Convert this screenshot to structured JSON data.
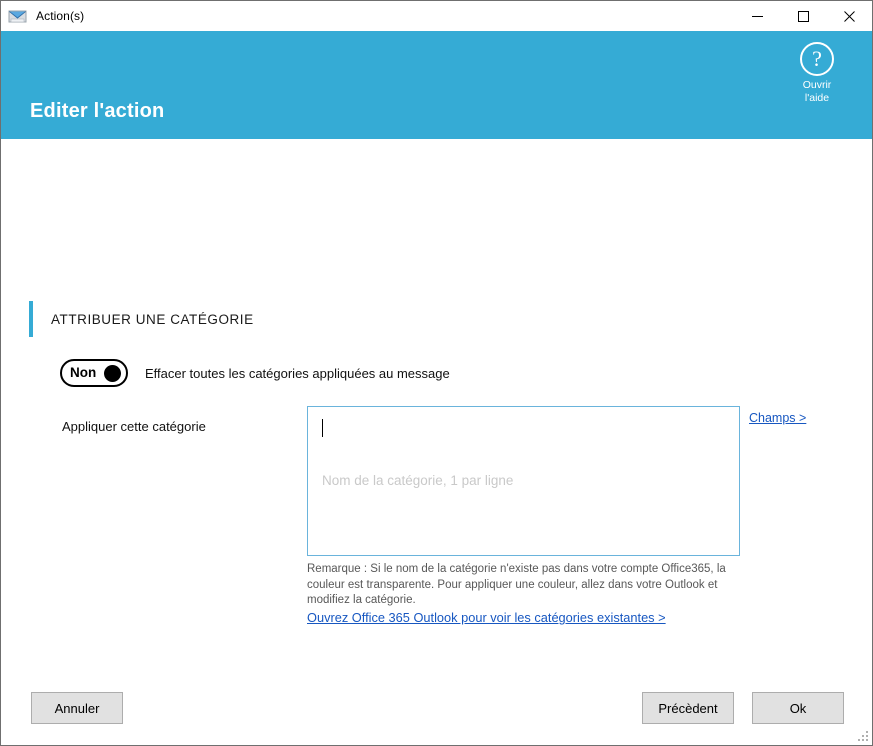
{
  "window": {
    "title": "Action(s)",
    "icon": "mail-envelope-icon",
    "controls": {
      "minimize": "minimize-icon",
      "maximize": "maximize-icon",
      "close": "close-icon"
    }
  },
  "header": {
    "title": "Editer l'action",
    "accent_color": "#35abd5",
    "help": {
      "icon": "question-mark-icon",
      "glyph": "?",
      "label_line1": "Ouvrir",
      "label_line2": "l'aide"
    }
  },
  "section": {
    "title": "ATTRIBUER UNE CATÉGORIE",
    "accent_color": "#35abd5"
  },
  "toggle": {
    "state_label": "Non",
    "description": "Effacer toutes les catégories appliquées au message"
  },
  "field": {
    "label": "Appliquer cette catégorie",
    "value": "",
    "placeholder": "Nom de la catégorie, 1 par ligne",
    "border_color": "#6ab4dc",
    "champs_link": "Champs >"
  },
  "remark": {
    "text": "Remarque : Si le nom de la catégorie n'existe pas dans votre compte Office365, la couleur est transparente. Pour appliquer une couleur, allez dans votre Outlook et modifiez la catégorie.",
    "link": "Ouvrez Office 365 Outlook pour voir les catégories existantes >",
    "link_color": "#1757c1"
  },
  "footer": {
    "cancel": "Annuler",
    "previous": "Précèdent",
    "ok": "Ok"
  }
}
